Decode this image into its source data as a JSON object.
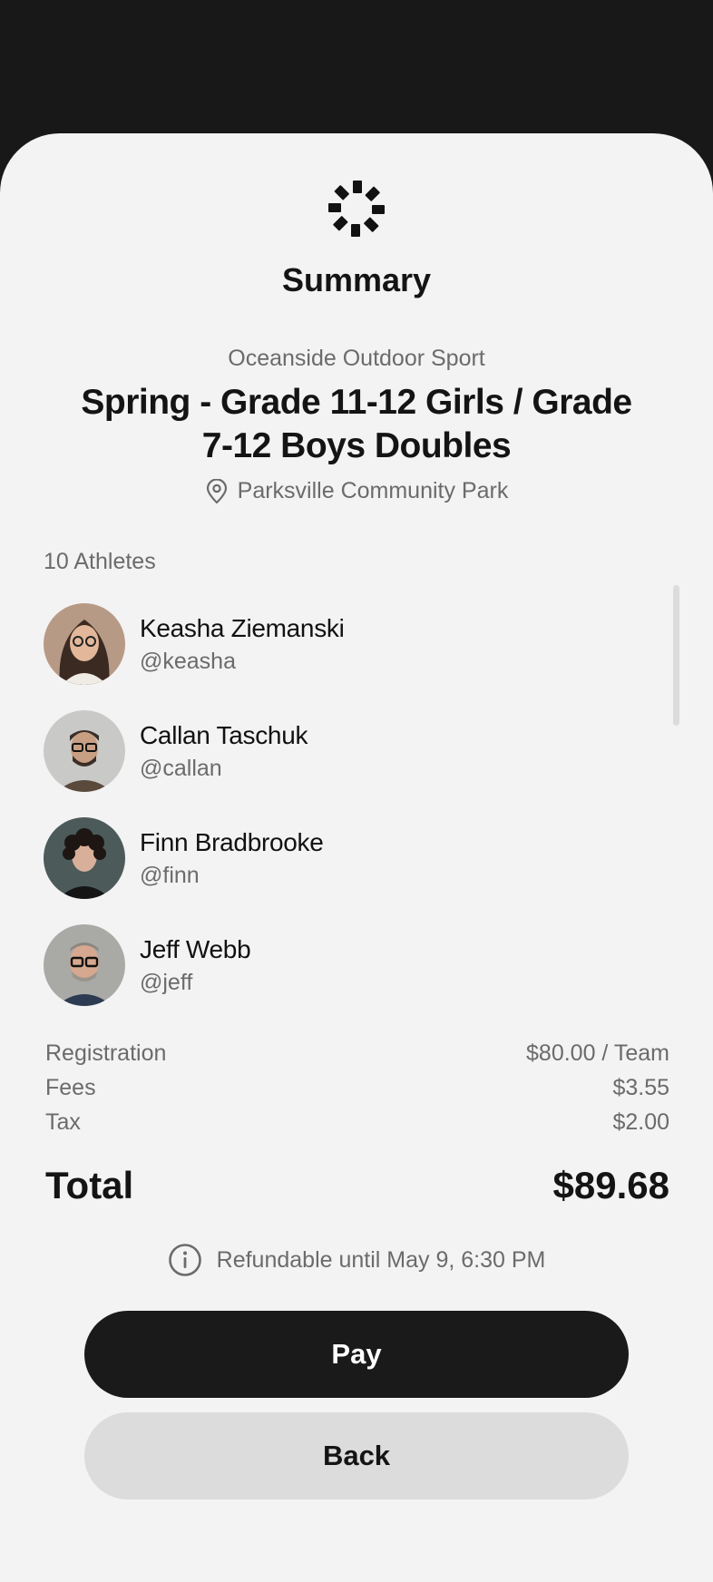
{
  "header": {
    "title": "Summary",
    "logo_icon": "asterisk-logo-icon"
  },
  "event": {
    "organizer": "Oceanside Outdoor Sport",
    "name": "Spring - Grade 11-12 Girls / Grade 7-12 Boys Doubles",
    "location": "Parksville Community Park",
    "location_icon": "map-pin-icon"
  },
  "athletes": {
    "count_label": "10 Athletes",
    "items": [
      {
        "name": "Keasha Ziemanski",
        "handle": "@keasha"
      },
      {
        "name": "Callan Taschuk",
        "handle": "@callan"
      },
      {
        "name": "Finn Bradbrooke",
        "handle": "@finn"
      },
      {
        "name": "Jeff Webb",
        "handle": "@jeff"
      }
    ]
  },
  "pricing": {
    "registration_label": "Registration",
    "registration_value": "$80.00 / Team",
    "fees_label": "Fees",
    "fees_value": "$3.55",
    "tax_label": "Tax",
    "tax_value": "$2.00",
    "total_label": "Total",
    "total_value": "$89.68"
  },
  "refund": {
    "text": "Refundable until May 9,  6:30 PM",
    "icon": "info-icon"
  },
  "actions": {
    "pay_label": "Pay",
    "back_label": "Back"
  },
  "colors": {
    "background_dark": "#181818",
    "sheet": "#f3f3f3",
    "primary_button": "#1a1a1a",
    "secondary_button": "#dcdcdc",
    "muted_text": "#6b6b6b"
  }
}
